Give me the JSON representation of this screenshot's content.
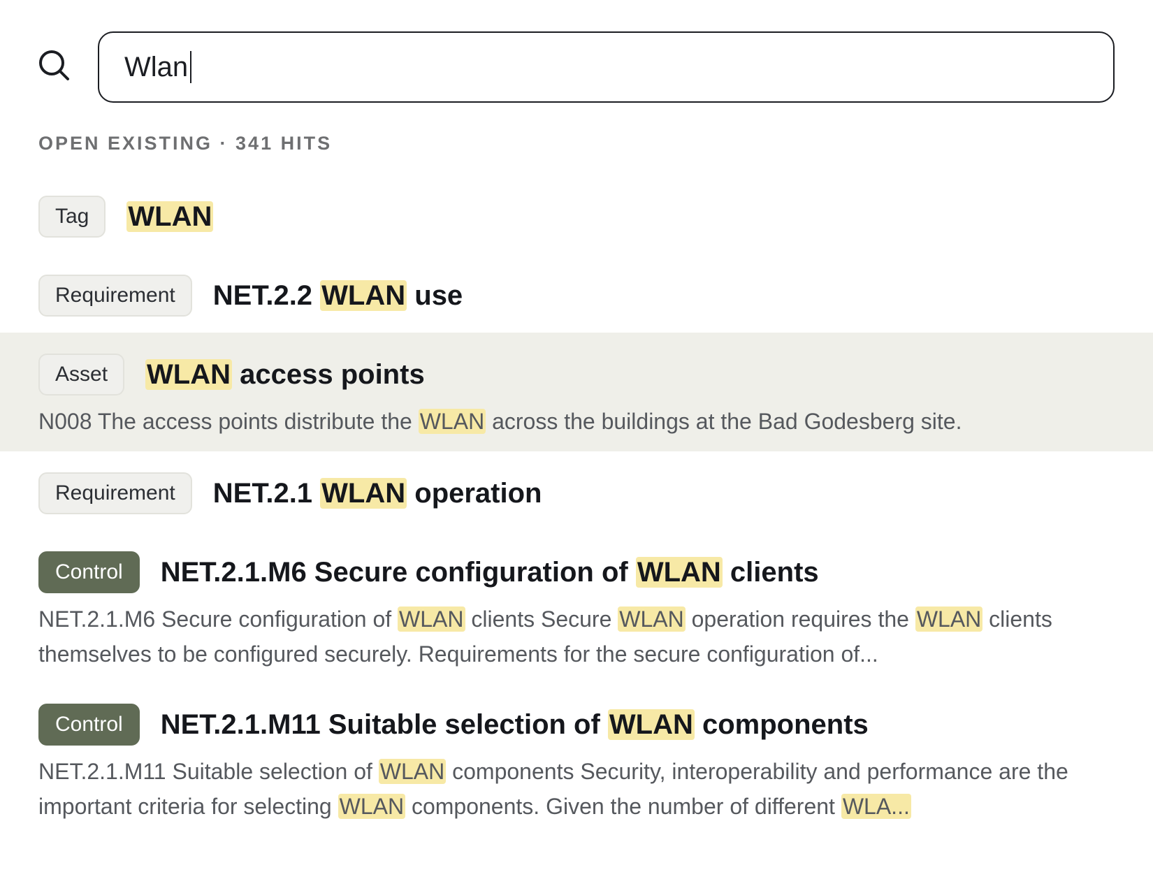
{
  "search": {
    "value": "Wlan"
  },
  "section": {
    "label": "OPEN EXISTING · 341 HITS"
  },
  "results": [
    {
      "type": "Tag",
      "title": [
        "",
        "WLAN",
        ""
      ],
      "desc": []
    },
    {
      "type": "Requirement",
      "title": [
        "NET.2.2 ",
        "WLAN",
        " use"
      ],
      "desc": []
    },
    {
      "type": "Asset",
      "title": [
        "",
        "WLAN",
        " access points"
      ],
      "desc": [
        "N008 The access points distribute the ",
        "WLAN",
        " across the buildings at the Bad Godesberg site."
      ]
    },
    {
      "type": "Requirement",
      "title": [
        "NET.2.1 ",
        "WLAN",
        " operation"
      ],
      "desc": []
    },
    {
      "type": "Control",
      "title": [
        "NET.2.1.M6 Secure configuration of ",
        "WLAN",
        " clients"
      ],
      "desc": [
        "NET.2.1.M6 Secure configuration of ",
        "WLAN",
        " clients Secure ",
        "WLAN",
        " operation requires the ",
        "WLAN",
        " clients themselves to be configured securely. Requirements for the secure configuration of..."
      ]
    },
    {
      "type": "Control",
      "title": [
        "NET.2.1.M11 Suitable selection of ",
        "WLAN",
        " components"
      ],
      "desc": [
        "NET.2.1.M11 Suitable selection of ",
        "WLAN",
        " components Security, interoperability and performance are the important criteria for selecting ",
        "WLAN",
        " components. Given the number of different ",
        "WLA..."
      ]
    }
  ]
}
